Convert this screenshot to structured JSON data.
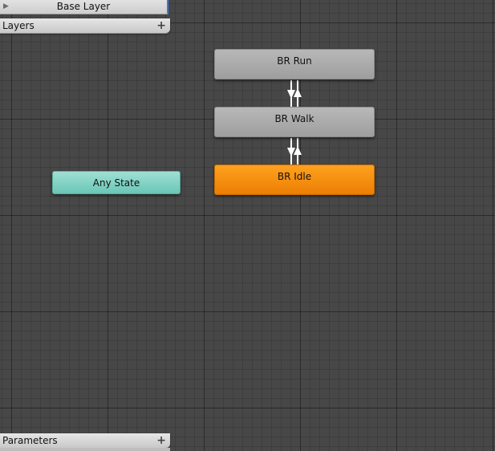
{
  "layers_panel": {
    "base_layer_label": "Base Layer",
    "fold_glyph": "▶",
    "header_label": "Layers",
    "add_glyph": "+"
  },
  "parameters_panel": {
    "header_label": "Parameters",
    "add_glyph": "+"
  },
  "states": {
    "run": {
      "label": "BR Run",
      "color": "#aaaaaa"
    },
    "walk": {
      "label": "BR Walk",
      "color": "#aaaaaa"
    },
    "idle": {
      "label": "BR Idle",
      "color": "#f7900f",
      "is_default": true
    },
    "any": {
      "label": "Any State",
      "color": "#7fd1c3"
    }
  },
  "transitions": [
    {
      "from": "BR Walk",
      "to": "BR Run"
    },
    {
      "from": "BR Run",
      "to": "BR Walk"
    },
    {
      "from": "BR Idle",
      "to": "BR Walk"
    },
    {
      "from": "BR Walk",
      "to": "BR Idle"
    }
  ],
  "colors": {
    "grid_background": "#474747",
    "selection_accent": "#3d7bd4",
    "transition_line": "#ffffff"
  }
}
